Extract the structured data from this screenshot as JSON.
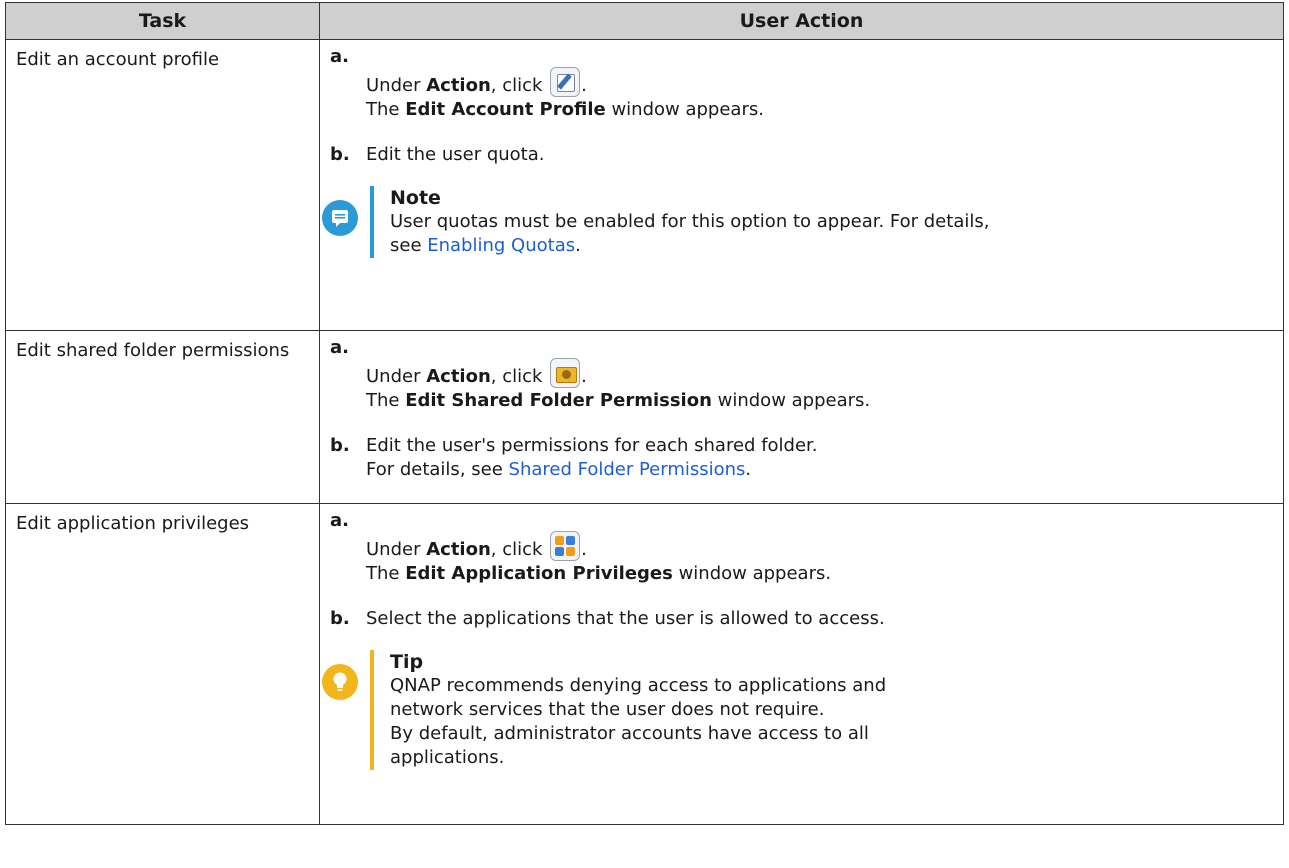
{
  "headers": {
    "task": "Task",
    "user_action": "User Action"
  },
  "rows": [
    {
      "task": "Edit an account profile",
      "a": {
        "letter": "a.",
        "pre": "Under ",
        "bold": "Action",
        "post": ", click ",
        "period": ".",
        "line2_pre": "The ",
        "line2_bold": "Edit Account Profile",
        "line2_post": " window appears.",
        "icon": "edit-profile-icon"
      },
      "b": {
        "letter": "b.",
        "text": "Edit the user quota."
      },
      "note": {
        "title": "Note",
        "text": "User quotas must be enabled for this option to appear. For details, see ",
        "link": "Enabling Quotas",
        "end": "."
      }
    },
    {
      "task": "Edit shared folder permissions",
      "a": {
        "letter": "a.",
        "pre": "Under ",
        "bold": "Action",
        "post": ", click ",
        "period": ".",
        "line2_pre": "The ",
        "line2_bold": "Edit Shared Folder Permission",
        "line2_post": " window appears.",
        "icon": "shared-folder-permission-icon"
      },
      "b": {
        "letter": "b.",
        "text": "Edit the user's permissions for each shared folder.",
        "line2_pre": "For details, see ",
        "link": "Shared Folder Permissions",
        "end": "."
      }
    },
    {
      "task": "Edit application privileges",
      "a": {
        "letter": "a.",
        "pre": "Under ",
        "bold": "Action",
        "post": ", click ",
        "period": ".",
        "line2_pre": "The ",
        "line2_bold": "Edit Application Privileges",
        "line2_post": " window appears.",
        "icon": "application-privileges-icon"
      },
      "b": {
        "letter": "b.",
        "text": "Select the applications that the user is allowed to access."
      },
      "tip": {
        "title": "Tip",
        "text1": "QNAP recommends denying access to applications and network services that the user does not require.",
        "text2": "By default, administrator accounts have access to all applications."
      }
    }
  ],
  "colors": {
    "link": "#1a5fd6",
    "header_bg": "#cfcfcf",
    "note": "#2a9bd6",
    "tip": "#f2b51c"
  }
}
